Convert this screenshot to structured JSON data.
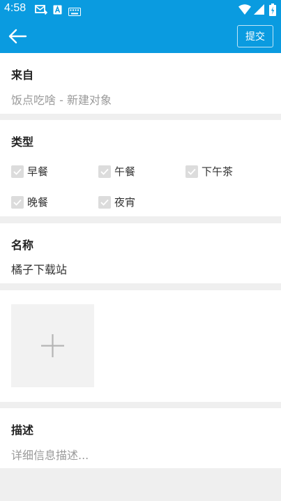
{
  "status_bar": {
    "time": "4:58",
    "icons": [
      "message-forward-icon",
      "font-a-icon",
      "keyboard-icon",
      "wifi-icon",
      "signal-icon",
      "battery-icon"
    ]
  },
  "toolbar": {
    "back_icon": "arrow-left-icon",
    "submit_label": "提交"
  },
  "source": {
    "label": "来自",
    "value": "饭点吃啥 - 新建对象"
  },
  "type": {
    "label": "类型",
    "options": [
      "早餐",
      "午餐",
      "下午茶",
      "晚餐",
      "夜宵"
    ]
  },
  "name": {
    "label": "名称",
    "value": "橘子下载站"
  },
  "image_add": {
    "icon": "plus-icon"
  },
  "description": {
    "label": "描述",
    "placeholder": "详细信息描述..."
  },
  "colors": {
    "primary": "#0a9be0",
    "annotation_arrow": "#e8432e",
    "background": "#efefef"
  }
}
